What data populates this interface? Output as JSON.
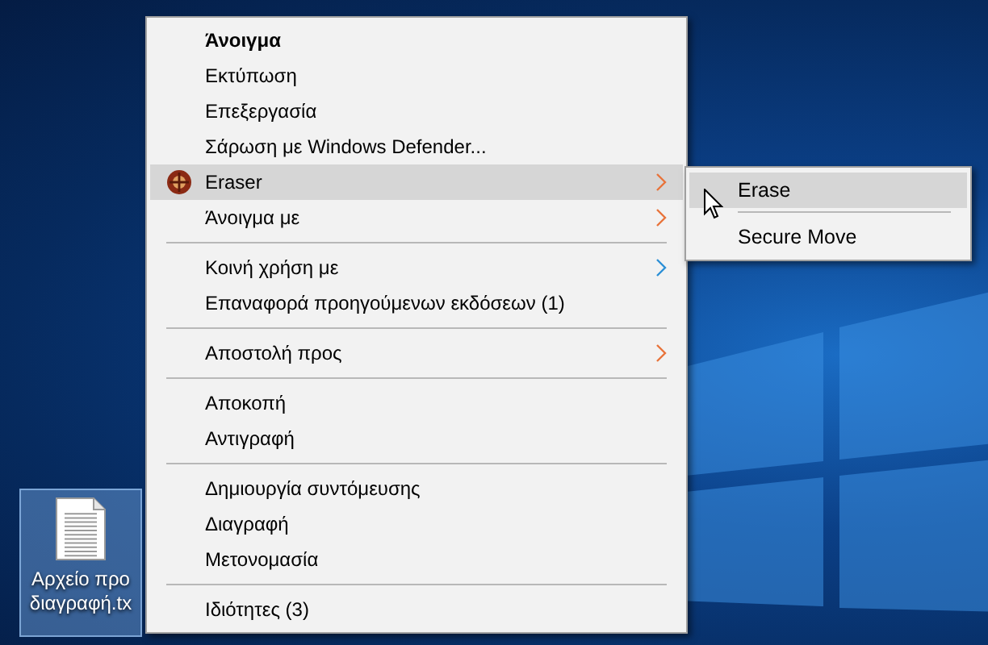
{
  "desktop_icon": {
    "label_lines": [
      "Αρχείο προ",
      "διαγραφή.tx"
    ],
    "selected": true
  },
  "context_menu": {
    "items": [
      {
        "kind": "item",
        "label": "Άνοιγμα",
        "bold": true,
        "submenu": false,
        "selected": false
      },
      {
        "kind": "item",
        "label": "Εκτύπωση",
        "bold": false,
        "submenu": false,
        "selected": false
      },
      {
        "kind": "item",
        "label": "Επεξεργασία",
        "bold": false,
        "submenu": false,
        "selected": false
      },
      {
        "kind": "item",
        "label": "Σάρωση με Windows Defender...",
        "bold": false,
        "submenu": false,
        "selected": false
      },
      {
        "kind": "icon_item",
        "label": "Eraser",
        "bold": false,
        "submenu": true,
        "color": "#e8733a",
        "selected": true
      },
      {
        "kind": "item",
        "label": "Άνοιγμα με",
        "bold": false,
        "submenu": true,
        "color": "#e8733a",
        "selected": false
      },
      {
        "kind": "separator"
      },
      {
        "kind": "item",
        "label": "Κοινή χρήση με",
        "bold": false,
        "submenu": true,
        "color": "#2b8fd6",
        "selected": false
      },
      {
        "kind": "item",
        "label": "Επαναφορά προηγούμενων εκδόσεων (1)",
        "bold": false,
        "submenu": false,
        "selected": false
      },
      {
        "kind": "separator"
      },
      {
        "kind": "item",
        "label": "Αποστολή προς",
        "bold": false,
        "submenu": true,
        "color": "#e8733a",
        "selected": false
      },
      {
        "kind": "separator"
      },
      {
        "kind": "item",
        "label": "Αποκοπή",
        "bold": false,
        "submenu": false,
        "selected": false
      },
      {
        "kind": "item",
        "label": "Αντιγραφή",
        "bold": false,
        "submenu": false,
        "selected": false
      },
      {
        "kind": "separator"
      },
      {
        "kind": "item",
        "label": "Δημιουργία συντόμευσης",
        "bold": false,
        "submenu": false,
        "selected": false
      },
      {
        "kind": "item",
        "label": "Διαγραφή",
        "bold": false,
        "submenu": false,
        "selected": false
      },
      {
        "kind": "item",
        "label": "Μετονομασία",
        "bold": false,
        "submenu": false,
        "selected": false
      },
      {
        "kind": "separator"
      },
      {
        "kind": "item",
        "label": "Ιδιότητες (3)",
        "bold": false,
        "submenu": false,
        "selected": false
      }
    ]
  },
  "submenu": {
    "items": [
      {
        "kind": "item",
        "label": "Erase",
        "selected": true
      },
      {
        "kind": "separator"
      },
      {
        "kind": "item",
        "label": "Secure Move",
        "selected": false
      }
    ]
  }
}
